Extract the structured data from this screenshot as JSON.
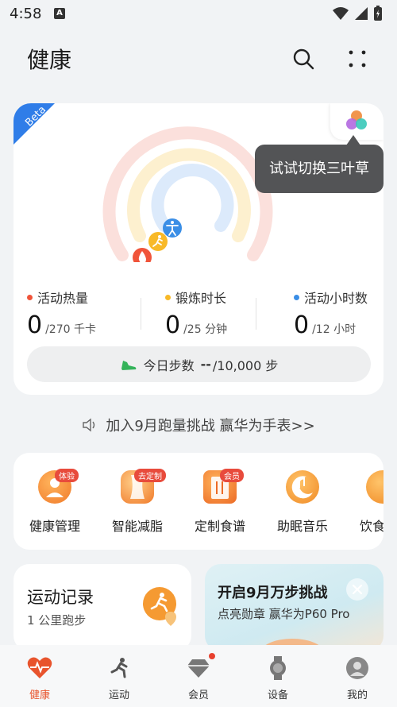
{
  "status_bar": {
    "time": "4:58",
    "notification_glyph": "A"
  },
  "header": {
    "title": "健康"
  },
  "rings": {
    "badge": "Beta",
    "tooltip": "试试切换三叶草",
    "stats": [
      {
        "label": "活动热量",
        "value": "0",
        "unit": "/270 千卡",
        "color": "#f0543a"
      },
      {
        "label": "锻炼时长",
        "value": "0",
        "unit": "/25 分钟",
        "color": "#f8b928"
      },
      {
        "label": "活动小时数",
        "value": "0",
        "unit": "/12 小时",
        "color": "#3a8ee6"
      }
    ],
    "steps_label": "今日步数",
    "steps_value": "--",
    "steps_goal": "/10,000 步"
  },
  "promo": {
    "text": "加入9月跑量挑战 赢华为手表>>"
  },
  "services": [
    {
      "label": "健康管理",
      "tag": "体验"
    },
    {
      "label": "智能减脂",
      "tag": "去定制"
    },
    {
      "label": "定制食谱",
      "tag": "会员"
    },
    {
      "label": "助眠音乐",
      "tag": ""
    },
    {
      "label": "饮食",
      "tag": ""
    }
  ],
  "record_card": {
    "title": "运动记录",
    "subtitle": "1 公里跑步"
  },
  "challenge_card": {
    "title": "开启9月万步挑战",
    "subtitle": "点亮勋章 赢华为P60 Pro"
  },
  "tabs": [
    {
      "label": "健康",
      "icon": "heart-pulse-icon",
      "active": true
    },
    {
      "label": "运动",
      "icon": "runner-icon",
      "active": false
    },
    {
      "label": "会员",
      "icon": "diamond-icon",
      "active": false
    },
    {
      "label": "设备",
      "icon": "watch-icon",
      "active": false
    },
    {
      "label": "我的",
      "icon": "profile-icon",
      "active": false
    }
  ],
  "colors": {
    "accent": "#e8542d",
    "ring_red": "#f0543a",
    "ring_yellow": "#f8b928",
    "ring_blue": "#3a8ee6"
  }
}
